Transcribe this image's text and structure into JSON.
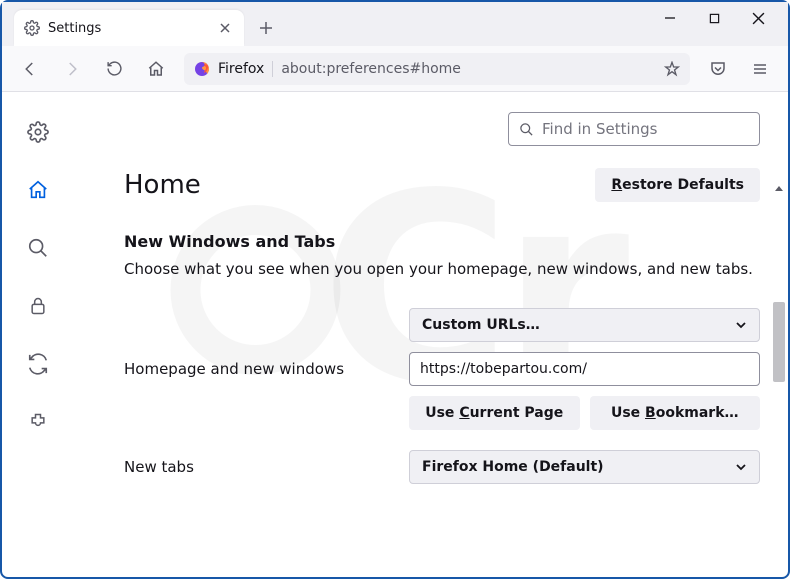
{
  "tab": {
    "title": "Settings"
  },
  "urlbar": {
    "identity": "Firefox",
    "url": "about:preferences#home"
  },
  "search": {
    "placeholder": "Find in Settings"
  },
  "page": {
    "title": "Home",
    "restore_btn": "Restore Defaults",
    "section_heading": "New Windows and Tabs",
    "section_desc": "Choose what you see when you open your homepage, new windows, and new tabs.",
    "homepage_label": "Homepage and new windows",
    "homepage_select": "Custom URLs…",
    "homepage_url": "https://tobepartou.com/",
    "use_current_btn": "Use Current Page",
    "use_bookmark_btn": "Use Bookmark…",
    "newtabs_label": "New tabs",
    "newtabs_select": "Firefox Home (Default)"
  }
}
